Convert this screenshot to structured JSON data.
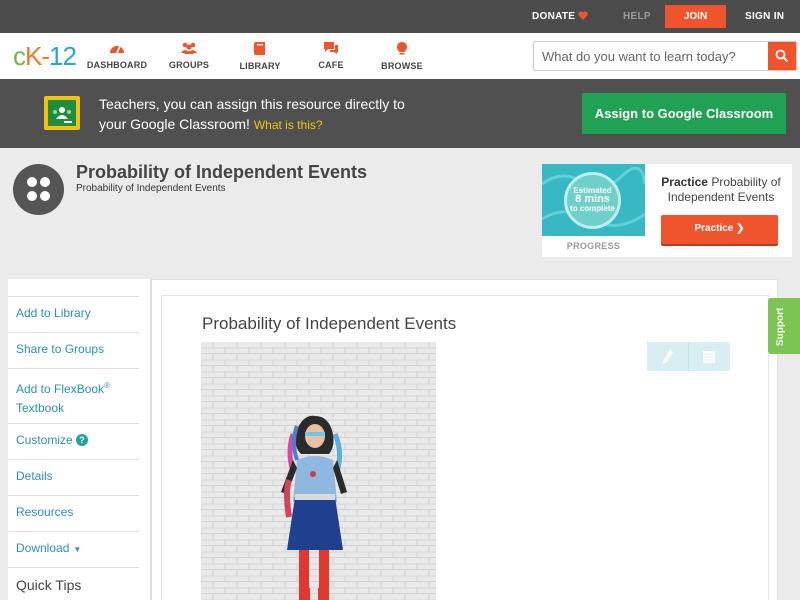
{
  "topbar": {
    "donate": "DONATE",
    "help": "HELP",
    "join": "JOIN",
    "sign_in": "SIGN IN",
    "heart_color": "#f0542c"
  },
  "logo": {
    "c": "c",
    "k": "K",
    "dash": "-",
    "num": "12"
  },
  "nav": {
    "items": [
      {
        "label": "DASHBOARD",
        "icon": "dashboard-icon"
      },
      {
        "label": "GROUPS",
        "icon": "groups-icon"
      },
      {
        "label": "LIBRARY",
        "icon": "library-icon"
      },
      {
        "label": "CAFE",
        "icon": "cafe-icon"
      },
      {
        "label": "BROWSE",
        "icon": "browse-icon"
      }
    ],
    "icon_color": "#f0542c"
  },
  "search": {
    "placeholder": "What do you want to learn today?"
  },
  "banner": {
    "line1": "Teachers, you can assign this resource directly to",
    "line2": "your Google Classroom!",
    "what": "What is this?",
    "assign": "Assign to Google Classroom"
  },
  "header": {
    "title": "Probability of Independent Events",
    "subtitle": "Probability of Independent Events"
  },
  "practice": {
    "estimated": "Estimated",
    "mins": "8 mins",
    "to_complete": "to complete",
    "progress": "PROGRESS",
    "label_bold": "Practice",
    "label_rest": "Probability of Independent Events",
    "button": "Practice"
  },
  "sidebar": {
    "add_library": "Add to Library",
    "share": "Share to Groups",
    "flexbook_1": "Add to FlexBook",
    "flexbook_reg": "®",
    "flexbook_2": "Textbook",
    "customize": "Customize",
    "details": "Details",
    "resources": "Resources",
    "download": "Download",
    "quick_tips": "Quick Tips"
  },
  "article": {
    "title": "Probability of Independent Events"
  },
  "support": "Support"
}
